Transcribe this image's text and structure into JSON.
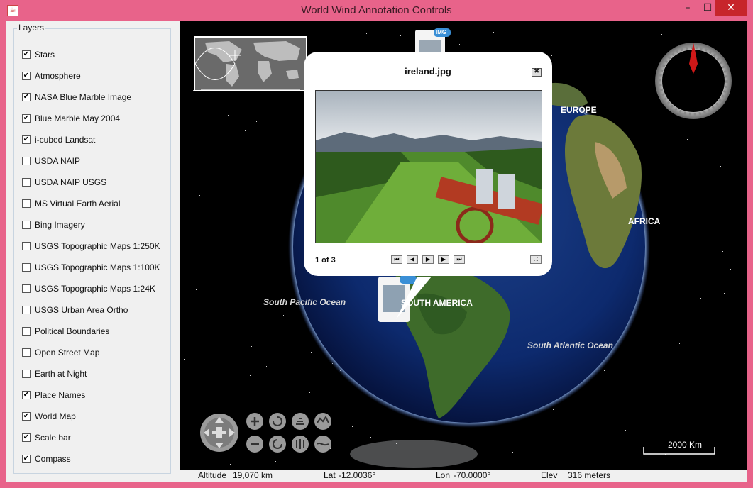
{
  "window": {
    "title": "World Wind Annotation Controls",
    "minimize": "–",
    "maximize": "☐",
    "close": "✕"
  },
  "layers": {
    "legend": "Layers",
    "items": [
      {
        "label": "Stars",
        "checked": true
      },
      {
        "label": "Atmosphere",
        "checked": true
      },
      {
        "label": "NASA Blue Marble Image",
        "checked": true
      },
      {
        "label": "Blue Marble May 2004",
        "checked": true
      },
      {
        "label": "i-cubed Landsat",
        "checked": true
      },
      {
        "label": "USDA NAIP",
        "checked": false
      },
      {
        "label": "USDA NAIP USGS",
        "checked": false
      },
      {
        "label": "MS Virtual Earth Aerial",
        "checked": false
      },
      {
        "label": "Bing Imagery",
        "checked": false
      },
      {
        "label": "USGS Topographic Maps 1:250K",
        "checked": false
      },
      {
        "label": "USGS Topographic Maps 1:100K",
        "checked": false
      },
      {
        "label": "USGS Topographic Maps 1:24K",
        "checked": false
      },
      {
        "label": "USGS Urban Area Ortho",
        "checked": false
      },
      {
        "label": "Political Boundaries",
        "checked": false
      },
      {
        "label": "Open Street Map",
        "checked": false
      },
      {
        "label": "Earth at Night",
        "checked": false
      },
      {
        "label": "Place Names",
        "checked": true
      },
      {
        "label": "World Map",
        "checked": true
      },
      {
        "label": "Scale bar",
        "checked": true
      },
      {
        "label": "Compass",
        "checked": true
      }
    ]
  },
  "map": {
    "labels": {
      "europe": "EUROPE",
      "africa": "AFRICA",
      "south_america": "SOUTH AMERICA",
      "south_pacific": "South Pacific Ocean",
      "south_atlantic": "South Atlantic Ocean"
    },
    "img_badge": "IMG",
    "scale_label": "2000 Km",
    "colors": {
      "ocean": "#0d2a6e",
      "land": "#3e6b2a",
      "compass_needle": "#d01818"
    }
  },
  "annotation": {
    "title": "ireland.jpg",
    "pager": "1 of 3",
    "close_icon": "close-icon"
  },
  "status": {
    "altitude_label": "Altitude",
    "altitude_value": "19,070 km",
    "lat_label": "Lat",
    "lat_value": "-12.0036°",
    "lon_label": "Lon",
    "lon_value": "-70.0000°",
    "elev_label": "Elev",
    "elev_value": "316 meters"
  }
}
